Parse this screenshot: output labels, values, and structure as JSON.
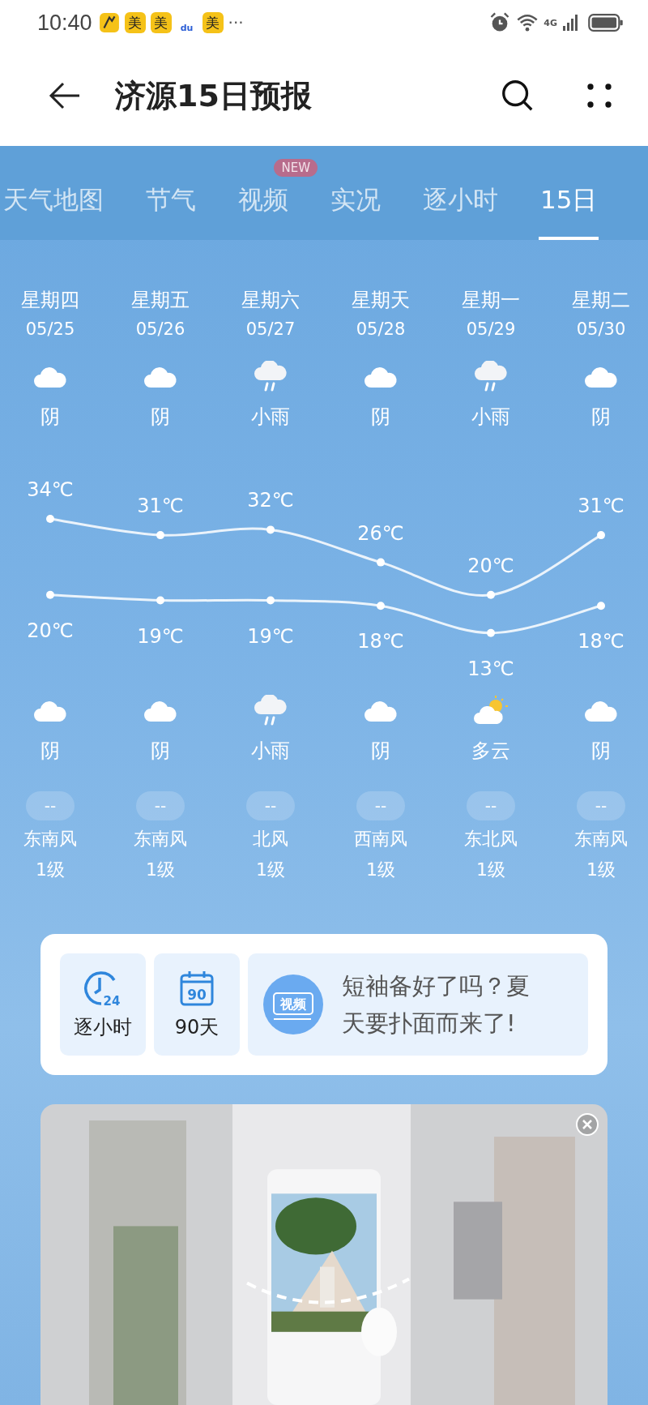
{
  "status_bar": {
    "time": "10:40",
    "notifications": [
      {
        "kind": "figure"
      },
      {
        "kind": "label",
        "text": "美"
      },
      {
        "kind": "label",
        "text": "美"
      },
      {
        "kind": "paw",
        "text": "du"
      },
      {
        "kind": "label",
        "text": "美"
      }
    ],
    "more": "···",
    "network": "4G"
  },
  "header": {
    "title": "济源15日预报"
  },
  "tabs": [
    {
      "label": "天气地图",
      "selected": false
    },
    {
      "label": "节气",
      "selected": false
    },
    {
      "label": "视频",
      "selected": false,
      "badge": "NEW"
    },
    {
      "label": "实况",
      "selected": false
    },
    {
      "label": "逐小时",
      "selected": false
    },
    {
      "label": "15日",
      "selected": true
    }
  ],
  "days": [
    {
      "weekday": "星期四",
      "date": "05/25",
      "day": {
        "kind": "cloudy",
        "text": "阴"
      },
      "night": {
        "kind": "cloudy",
        "text": "阴"
      },
      "aqi": "--",
      "wind_dir": "东南风",
      "wind_level": "1级"
    },
    {
      "weekday": "星期五",
      "date": "05/26",
      "day": {
        "kind": "cloudy",
        "text": "阴"
      },
      "night": {
        "kind": "cloudy",
        "text": "阴"
      },
      "aqi": "--",
      "wind_dir": "东南风",
      "wind_level": "1级"
    },
    {
      "weekday": "星期六",
      "date": "05/27",
      "day": {
        "kind": "rain",
        "text": "小雨"
      },
      "night": {
        "kind": "rain",
        "text": "小雨"
      },
      "aqi": "--",
      "wind_dir": "北风",
      "wind_level": "1级"
    },
    {
      "weekday": "星期天",
      "date": "05/28",
      "day": {
        "kind": "cloudy",
        "text": "阴"
      },
      "night": {
        "kind": "cloudy",
        "text": "阴"
      },
      "aqi": "--",
      "wind_dir": "西南风",
      "wind_level": "1级"
    },
    {
      "weekday": "星期一",
      "date": "05/29",
      "day": {
        "kind": "rain",
        "text": "小雨"
      },
      "night": {
        "kind": "partly",
        "text": "多云"
      },
      "aqi": "--",
      "wind_dir": "东北风",
      "wind_level": "1级"
    },
    {
      "weekday": "星期二",
      "date": "05/30",
      "day": {
        "kind": "cloudy",
        "text": "阴"
      },
      "night": {
        "kind": "cloudy",
        "text": "阴"
      },
      "aqi": "--",
      "wind_dir": "东南风",
      "wind_level": "1级"
    }
  ],
  "chart_data": {
    "type": "line",
    "data_labels": true,
    "series": [
      {
        "color": "#ffffff",
        "marker": "circle",
        "values": [
          34,
          31,
          32,
          26,
          20,
          31
        ],
        "value_labels": [
          "34℃",
          "31℃",
          "32℃",
          "26℃",
          "20℃",
          "31℃"
        ]
      },
      {
        "color": "#ffffff",
        "marker": "circle",
        "values": [
          20,
          19,
          19,
          18,
          13,
          18
        ],
        "value_labels": [
          "20℃",
          "19℃",
          "19℃",
          "18℃",
          "13℃",
          "18℃"
        ]
      }
    ]
  },
  "shortcuts": [
    {
      "kind": "clock",
      "badge": "24",
      "label": "逐小时"
    },
    {
      "kind": "calendar",
      "badge": "90",
      "label": "90天"
    }
  ],
  "promo": {
    "badge": "视频",
    "text": "短袖备好了吗？夏天要扑面而来了!"
  },
  "ad": {
    "kind": "picture",
    "closable": true
  }
}
